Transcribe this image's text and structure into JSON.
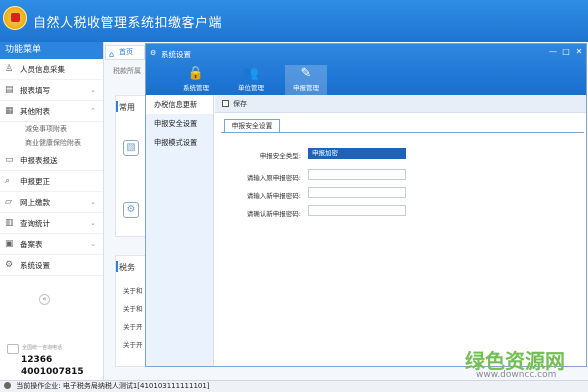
{
  "app": {
    "title": "自然人税收管理系统扣缴客户端"
  },
  "sidebar": {
    "header": "功能菜单",
    "items": [
      {
        "label": "人员信息采集",
        "icon": "person-icon"
      },
      {
        "label": "报表填写",
        "icon": "form-icon"
      },
      {
        "label": "其他附表",
        "icon": "grid-icon",
        "children": [
          "减免事项附表",
          "商业健康保险附表"
        ]
      },
      {
        "label": "申报表报送",
        "icon": "send-icon"
      },
      {
        "label": "申报更正",
        "icon": "search-icon"
      },
      {
        "label": "网上缴款",
        "icon": "folder-icon"
      },
      {
        "label": "查询统计",
        "icon": "chart-icon"
      },
      {
        "label": "备案表",
        "icon": "document-icon"
      },
      {
        "label": "系统设置",
        "icon": "gear-icon"
      }
    ],
    "hotline_caption": "全国统一咨询电话",
    "hotline_numbers": [
      "12366",
      "4001007815"
    ]
  },
  "main": {
    "tab": "首页",
    "breadcrumb": "税款所属",
    "panel1_title": "常用",
    "panel2_title": "税务",
    "tax_lines": [
      "关于和",
      "关于和",
      "关于开",
      "关于开"
    ]
  },
  "status": {
    "text": "当前操作企业: 电子税务局纳税人测试1[410103111111101]"
  },
  "dialog": {
    "title": "系统设置",
    "tools": [
      {
        "label": "系统管理",
        "icon": "lock-icon"
      },
      {
        "label": "单位管理",
        "icon": "users-icon"
      },
      {
        "label": "申报管理",
        "icon": "edit-icon"
      }
    ],
    "left_nav": [
      "办税信息更新",
      "申报安全设置",
      "申报模式设置"
    ],
    "toolbar": {
      "save_label": "保存"
    },
    "subtab": "申报安全设置",
    "form": {
      "security_type_label": "申报安全类型:",
      "security_type_value": "申报加密",
      "original_password_label": "请输入原申报密码:",
      "new_password_label": "请输入新申报密码:",
      "confirm_password_label": "请确认新申报密码:"
    }
  },
  "watermark": {
    "text": "绿色资源网",
    "url": "www.downcc.com"
  }
}
